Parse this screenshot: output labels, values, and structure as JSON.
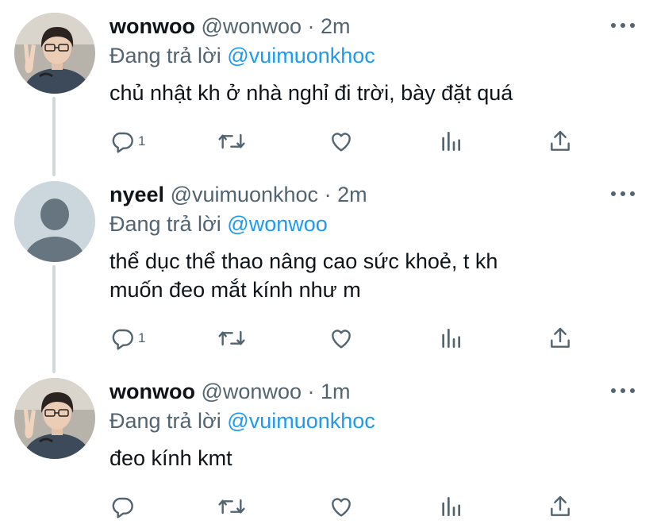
{
  "tweets": [
    {
      "name": "wonwoo",
      "handle": "@wonwoo",
      "separator": "·",
      "time": "2m",
      "reply_prefix": "Đang trả lời",
      "reply_to": "@vuimuonkhoc",
      "lines": [
        "chủ nhật kh ở nhà nghỉ đi trời, bày đặt quá"
      ],
      "reply_count": "1",
      "avatar": "profile-photo-person"
    },
    {
      "name": "nyeel",
      "handle": "@vuimuonkhoc",
      "separator": "·",
      "time": "2m",
      "reply_prefix": "Đang trả lời",
      "reply_to": "@wonwoo",
      "lines": [
        "thể dục thể thao nâng cao sức khoẻ, t kh",
        "muốn đeo mắt kính như m"
      ],
      "reply_count": "1",
      "avatar": "default-avatar-silhouette"
    },
    {
      "name": "wonwoo",
      "handle": "@wonwoo",
      "separator": "·",
      "time": "1m",
      "reply_prefix": "Đang trả lời",
      "reply_to": "@vuimuonkhoc",
      "lines": [
        "đeo kính kmt"
      ],
      "reply_count": "",
      "avatar": "profile-photo-person"
    }
  ],
  "icons": [
    "more-icon",
    "reply-icon",
    "retweet-icon",
    "like-icon",
    "analytics-icon",
    "share-icon"
  ],
  "colors": {
    "text": "#0f1419",
    "secondary": "#536471",
    "link": "#1d9bf0",
    "thread_line": "#cfd9de"
  }
}
